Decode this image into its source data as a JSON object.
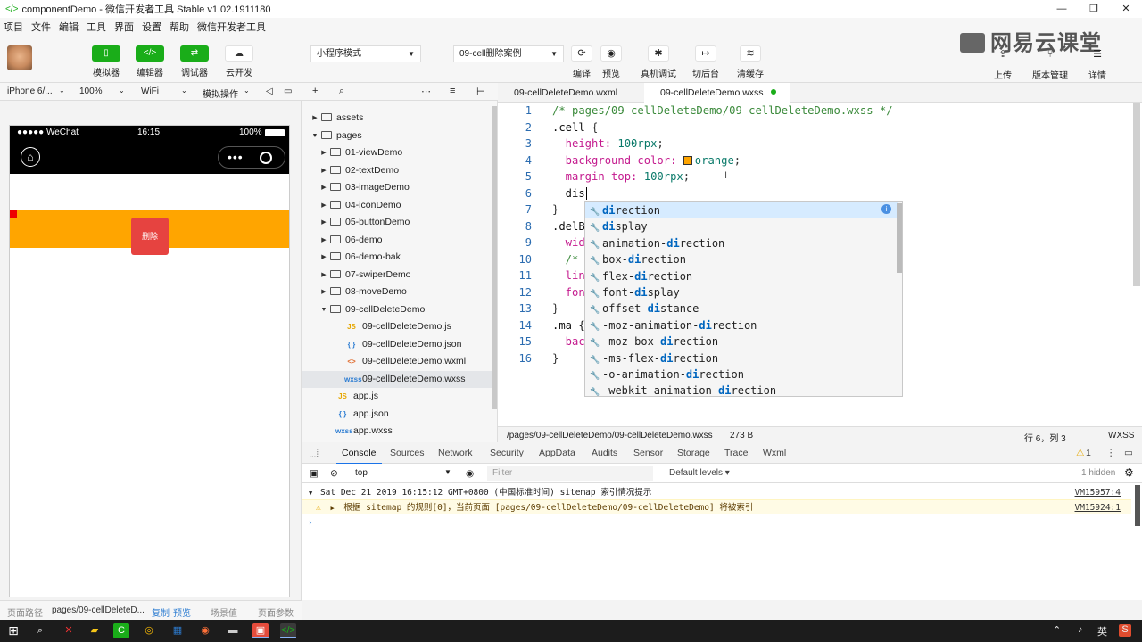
{
  "window": {
    "title": "componentDemo - 微信开发者工具 Stable v1.02.1911180"
  },
  "menu": [
    "项目",
    "文件",
    "编辑",
    "工具",
    "界面",
    "设置",
    "帮助",
    "微信开发者工具"
  ],
  "toolbar": {
    "simulator": "模拟器",
    "editor_label": "编辑器",
    "debugger": "调试器",
    "cloud": "云开发",
    "mode_select": "小程序模式",
    "compile_select": "09-cell删除案例",
    "compile": "编译",
    "preview": "预览",
    "remote_debug": "真机调试",
    "background": "切后台",
    "clear_cache": "清缓存",
    "upload": "上传",
    "version": "版本管理",
    "details": "详情",
    "brand": "网易云课堂"
  },
  "simbar": {
    "device": "iPhone 6/...",
    "zoom": "100%",
    "network": "WiFi",
    "op": "模拟操作"
  },
  "phone": {
    "carrier": "●●●●● WeChat",
    "time": "16:15",
    "battery": "100%",
    "delete_label": "删除",
    "capsule_dots": "•••"
  },
  "bottombar": {
    "path_label": "页面路径",
    "path": "pages/09-cellDeleteD...",
    "copy": "复制",
    "preview": "预览",
    "scene": "场景值",
    "params": "页面参数"
  },
  "filetree": {
    "items": [
      {
        "label": "assets",
        "kind": "folder",
        "arrow": "▶"
      },
      {
        "label": "pages",
        "kind": "folder",
        "arrow": "▼"
      },
      {
        "label": "01-viewDemo",
        "kind": "folder",
        "arrow": "▶"
      },
      {
        "label": "02-textDemo",
        "kind": "folder",
        "arrow": "▶"
      },
      {
        "label": "03-imageDemo",
        "kind": "folder",
        "arrow": "▶"
      },
      {
        "label": "04-iconDemo",
        "kind": "folder",
        "arrow": "▶"
      },
      {
        "label": "05-buttonDemo",
        "kind": "folder",
        "arrow": "▶"
      },
      {
        "label": "06-demo",
        "kind": "folder",
        "arrow": "▶"
      },
      {
        "label": "06-demo-bak",
        "kind": "folder",
        "arrow": "▶"
      },
      {
        "label": "07-swiperDemo",
        "kind": "folder",
        "arrow": "▶"
      },
      {
        "label": "08-moveDemo",
        "kind": "folder",
        "arrow": "▶"
      },
      {
        "label": "09-cellDeleteDemo",
        "kind": "folder",
        "arrow": "▼"
      },
      {
        "label": "09-cellDeleteDemo.js",
        "kind": "js",
        "tag": "JS",
        "color": "#e6a700"
      },
      {
        "label": "09-cellDeleteDemo.json",
        "kind": "json",
        "tag": "{ }",
        "color": "#2d7dd2"
      },
      {
        "label": "09-cellDeleteDemo.wxml",
        "kind": "wxml",
        "tag": "<>",
        "color": "#e06c2e"
      },
      {
        "label": "09-cellDeleteDemo.wxss",
        "kind": "wxss",
        "tag": "wxss",
        "color": "#2d7dd2"
      },
      {
        "label": "app.js",
        "kind": "js",
        "tag": "JS",
        "color": "#e6a700"
      },
      {
        "label": "app.json",
        "kind": "json",
        "tag": "{ }",
        "color": "#2d7dd2"
      },
      {
        "label": "app.wxss",
        "kind": "wxss",
        "tag": "wxss",
        "color": "#2d7dd2"
      }
    ]
  },
  "tabs": [
    {
      "label": "09-cellDeleteDemo.wxml"
    },
    {
      "label": "09-cellDeleteDemo.wxss"
    }
  ],
  "editor": {
    "lines": [
      "1",
      "2",
      "3",
      "4",
      "5",
      "6",
      "7",
      "8",
      "9",
      "10",
      "11",
      "12",
      "13",
      "14",
      "15",
      "16"
    ],
    "code": {
      "l1": "/* pages/09-cellDeleteDemo/09-cellDeleteDemo.wxss */",
      "l2_sel": ".cell",
      "l2_brace": " {",
      "l3_prop": "  height:",
      "l3_val": " 100rpx",
      "l3_end": ";",
      "l4_prop": "  background-color:",
      "l4_val": "orange",
      "l4_end": ";",
      "l5_prop": "  margin-top:",
      "l5_val": " 100rpx",
      "l5_end": ";",
      "l6": "  dis",
      "l7": "}",
      "l8": ".delB",
      "l9": "  wid",
      "l10": "  /*",
      "l11": "  lin",
      "l12": "  fon",
      "l13": "}",
      "l14": ".ma {",
      "l15": "  bac",
      "l16": "}"
    }
  },
  "suggestions": [
    {
      "pre": "",
      "hit": "di",
      "post": "rection"
    },
    {
      "pre": "",
      "hit": "di",
      "post": "splay"
    },
    {
      "pre": "animation-",
      "hit": "di",
      "post": "rection"
    },
    {
      "pre": "box-",
      "hit": "di",
      "post": "rection"
    },
    {
      "pre": "flex-",
      "hit": "di",
      "post": "rection"
    },
    {
      "pre": "font-",
      "hit": "di",
      "post": "splay"
    },
    {
      "pre": "offset-",
      "hit": "di",
      "post": "stance"
    },
    {
      "pre": "-moz-animation-",
      "hit": "di",
      "post": "rection"
    },
    {
      "pre": "-moz-box-",
      "hit": "di",
      "post": "rection"
    },
    {
      "pre": "-ms-flex-",
      "hit": "di",
      "post": "rection"
    },
    {
      "pre": "-o-animation-",
      "hit": "di",
      "post": "rection"
    },
    {
      "pre": "-webkit-animation-",
      "hit": "di",
      "post": "rection"
    }
  ],
  "edstatus": {
    "path": "/pages/09-cellDeleteDemo/09-cellDeleteDemo.wxss",
    "size": "273 B",
    "pos": "行 6，列 3",
    "lang": "WXSS"
  },
  "devtools": {
    "tabs": [
      "Console",
      "Sources",
      "Network",
      "Security",
      "AppData",
      "Audits",
      "Sensor",
      "Storage",
      "Trace",
      "Wxml"
    ],
    "warn_count": "1",
    "context": "top",
    "filter_placeholder": "Filter",
    "levels": "Default levels ▾",
    "hidden": "1 hidden",
    "log1": "Sat Dec 21 2019 16:15:12 GMT+0800 (中国标准时间) sitemap 索引情况提示",
    "log1_src": "VM15957:4",
    "log2": "根据 sitemap 的规则[0]，当前页面 [pages/09-cellDeleteDemo/09-cellDeleteDemo] 将被索引",
    "log2_src": "VM15924:1"
  },
  "taskbar": {
    "ime": "英"
  }
}
